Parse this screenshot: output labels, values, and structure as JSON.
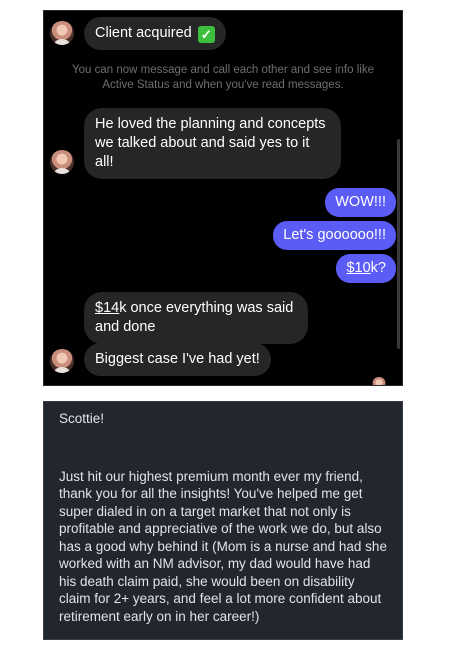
{
  "chat": {
    "first_message": "Client acquired",
    "first_message_emoji": "✓",
    "system_notice": "You can now message and call each other and see info like Active Status and when you've read messages.",
    "message_2": "He loved the planning and concepts we talked about and said yes to it all!",
    "outgoing": [
      "WOW!!!",
      "Let's goooooo!!!"
    ],
    "outgoing_3_link": "$10",
    "outgoing_3_suffix": "k?",
    "message_3_link": "$14",
    "message_3_suffix": "k once everything was said and done",
    "message_4": "Biggest case I've had yet!"
  },
  "note": {
    "greeting": "Scottie!",
    "body": "Just hit our highest premium month ever my friend, thank you for all the insights! You've helped me get super dialed in on a target market that not only is profitable and appreciative of the work we do, but also has a good why behind it (Mom is a nurse and had she worked with an NM advisor, my dad would have had his death claim paid, she would been on disability claim for 2+ years, and feel a lot more confident about retirement early on in her career!)"
  },
  "colors": {
    "chat_background": "#000000",
    "incoming_bubble": "#262626",
    "outgoing_bubble": "#5b5bf6",
    "note_background": "#22272e"
  }
}
